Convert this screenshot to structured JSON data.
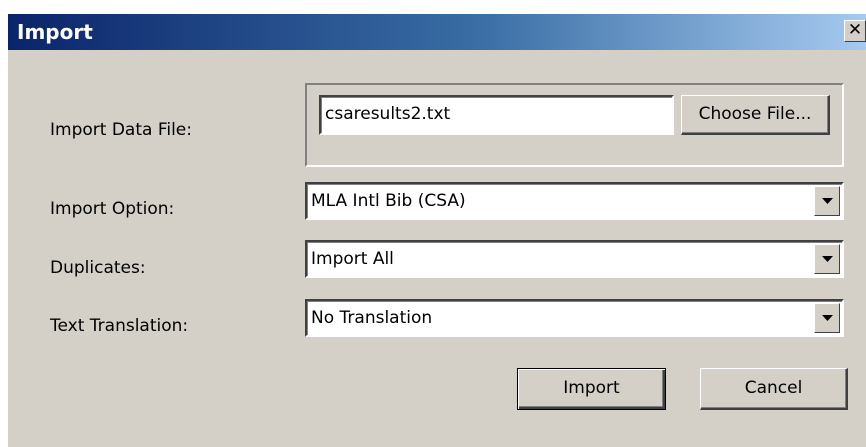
{
  "dialog": {
    "title": "Import",
    "close_glyph": "✕"
  },
  "fields": {
    "import_data_file": {
      "label": "Import Data File:",
      "value": "csaresults2.txt",
      "choose_button": "Choose File..."
    },
    "import_option": {
      "label": "Import Option:",
      "value": "MLA Intl Bib (CSA)"
    },
    "duplicates": {
      "label": "Duplicates:",
      "value": "Import All"
    },
    "text_translation": {
      "label": "Text Translation:",
      "value": "No Translation"
    }
  },
  "buttons": {
    "import": "Import",
    "cancel": "Cancel"
  },
  "colors": {
    "dialog_face": "#d4d0c8",
    "title_gradient_start": "#0a246a",
    "title_gradient_end": "#a6caf0"
  },
  "icons": {
    "close": "close-icon",
    "dropdown": "chevron-down-icon"
  }
}
